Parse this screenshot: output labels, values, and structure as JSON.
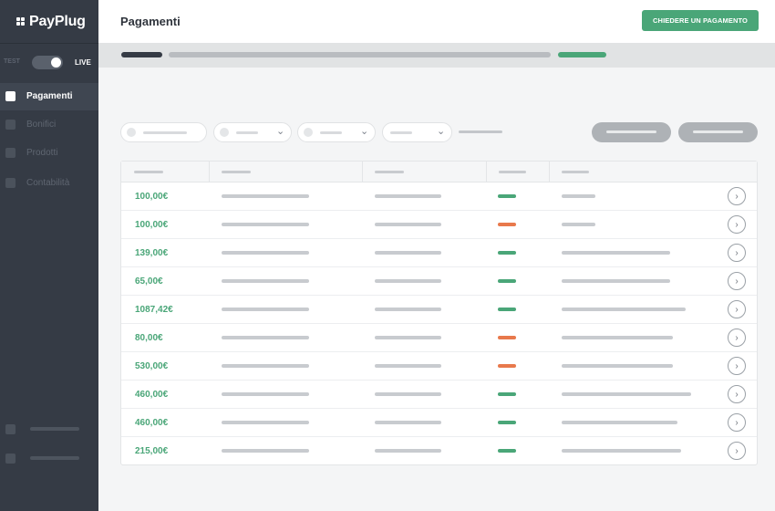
{
  "app": {
    "name": "PayPlug"
  },
  "sidebar": {
    "mode_toggle": {
      "off_label": "TEST",
      "on_label": "LIVE",
      "is_live": true
    },
    "items": [
      {
        "label": "Pagamenti",
        "active": true
      },
      {
        "label": "Bonifici",
        "active": false
      },
      {
        "label": "Prodotti",
        "active": false
      },
      {
        "label": "Contabilità",
        "active": false
      }
    ]
  },
  "header": {
    "title": "Pagamenti",
    "primary_action": "CHIEDERE UN PAGAMENTO"
  },
  "colors": {
    "brand_green": "#4aa678",
    "status_ok": "#4aa678",
    "status_failed": "#e8794c",
    "sidebar_bg": "#353b45"
  },
  "payments": {
    "rows": [
      {
        "amount": "100,00€",
        "status": "ok"
      },
      {
        "amount": "100,00€",
        "status": "failed"
      },
      {
        "amount": "139,00€",
        "status": "ok"
      },
      {
        "amount": "65,00€",
        "status": "ok"
      },
      {
        "amount": "1087,42€",
        "status": "ok"
      },
      {
        "amount": "80,00€",
        "status": "failed"
      },
      {
        "amount": "530,00€",
        "status": "failed"
      },
      {
        "amount": "460,00€",
        "status": "ok"
      },
      {
        "amount": "460,00€",
        "status": "ok"
      },
      {
        "amount": "215,00€",
        "status": "ok"
      }
    ]
  }
}
